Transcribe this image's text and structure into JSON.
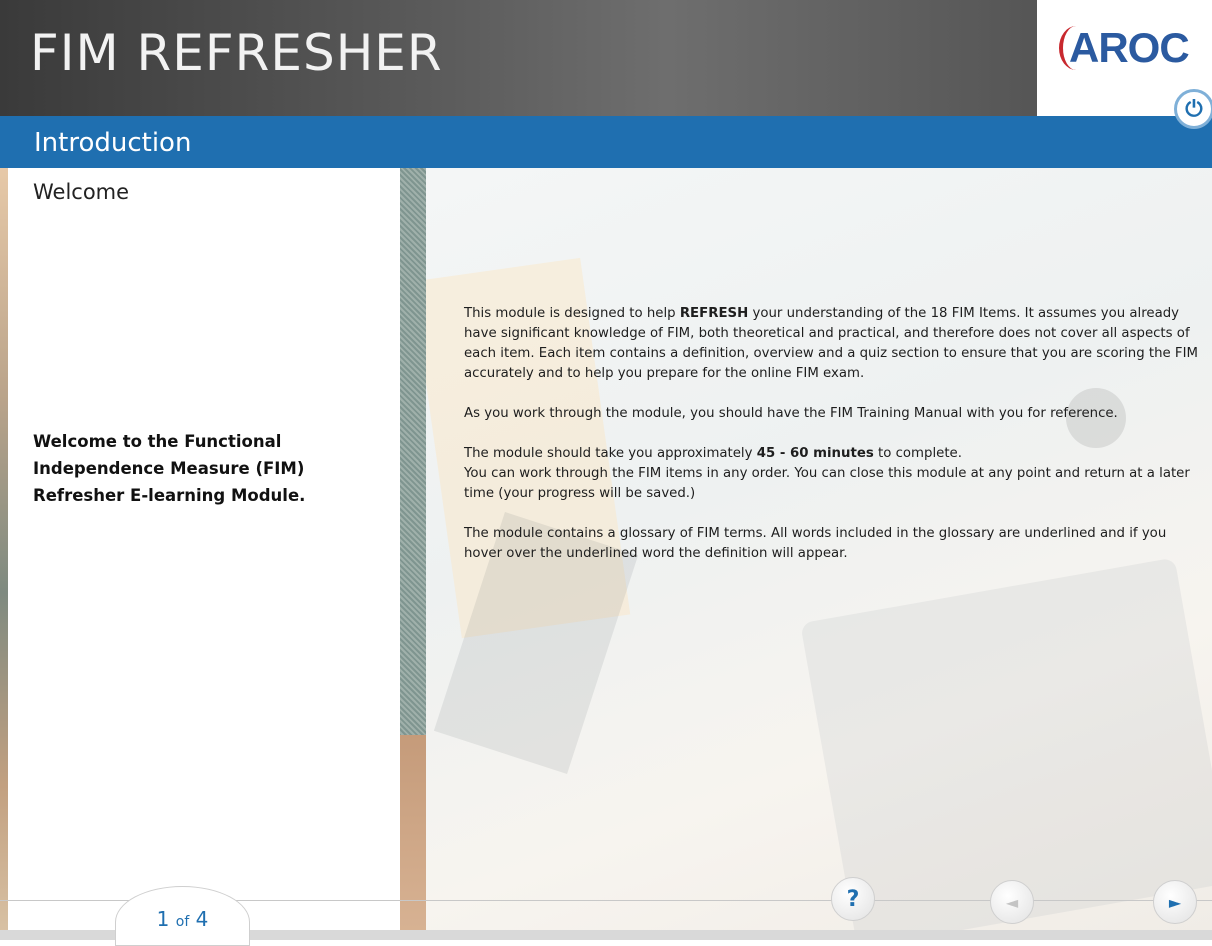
{
  "app": {
    "title": "FIM REFRESHER",
    "logo_text": "AROC"
  },
  "section": {
    "title": "Introduction"
  },
  "left": {
    "heading": "Welcome",
    "intro": "Welcome to the Functional Independence Measure (FIM) Refresher E-learning Module."
  },
  "content": {
    "p1_before": "This module is designed to help ",
    "p1_bold": "REFRESH",
    "p1_after": " your understanding of the 18 FIM Items. It assumes you already have significant knowledge of FIM, both theoretical and practical, and therefore does not cover all aspects of each item. Each item contains a definition, overview and a quiz section to ensure that you are scoring the FIM accurately and to help you prepare for the online FIM exam.",
    "p2": "As you work through the module, you should have the FIM Training Manual with you for reference.",
    "p3_before": "The module should take you approximately ",
    "p3_bold": "45 - 60 minutes",
    "p3_after": " to complete.",
    "p3_line2": "You can work through the FIM items in any order. You can close this module at any point and return at a later time (your progress will be saved.)",
    "p4": "The module contains a glossary of FIM terms. All words included in the glossary are underlined and if you hover over the underlined word the definition will appear."
  },
  "nav": {
    "current_page": "1",
    "of_label": "of",
    "total_pages": "4",
    "help_symbol": "?",
    "back_symbol": "◄",
    "next_symbol": "►"
  },
  "icons": {
    "power": "power-icon",
    "help": "help-icon",
    "back": "back-arrow-icon",
    "next": "next-arrow-icon"
  },
  "colors": {
    "accent": "#1f6fb0",
    "header_dark": "#3a3a3a",
    "logo_blue": "#2b5aa0",
    "logo_red": "#c8282e"
  }
}
